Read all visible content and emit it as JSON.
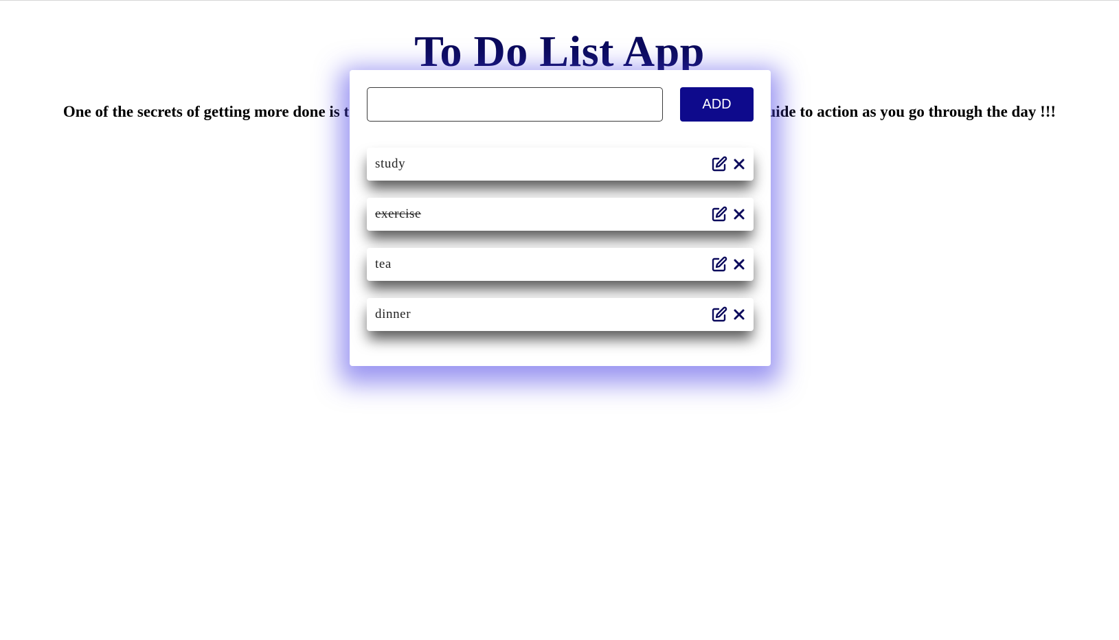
{
  "app": {
    "title": "To Do List App",
    "tagline": "One of the secrets of getting more done is to make a To Do List every day, keep it visible, and use it as a guide to action as you go through the day !!!"
  },
  "form": {
    "input_value": "",
    "add_label": "ADD"
  },
  "tasks": [
    {
      "text": "study",
      "completed": false
    },
    {
      "text": "exercise",
      "completed": true
    },
    {
      "text": "tea",
      "completed": false
    },
    {
      "text": "dinner",
      "completed": false
    }
  ],
  "icons": {
    "edit": "edit-icon",
    "delete": "close-icon"
  },
  "colors": {
    "title": "#0b0a5c",
    "accent": "#0e0a8c",
    "icon": "#0b0a5c",
    "card_glow": "#4840e6"
  }
}
